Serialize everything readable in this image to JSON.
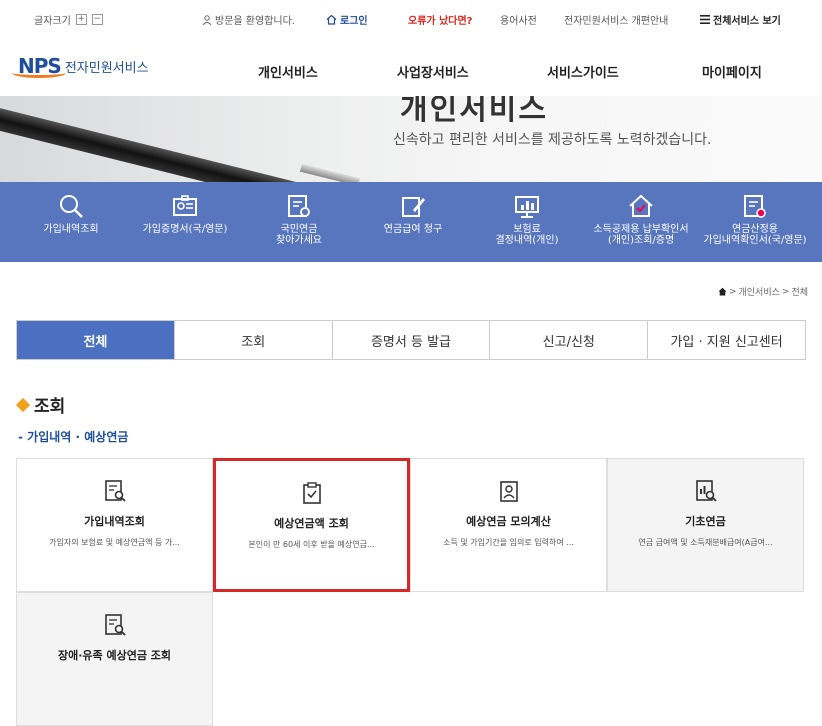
{
  "topbar": {
    "font_size_label": "글자크기",
    "font_plus": "+",
    "font_minus": "−",
    "welcome": "방문을 환영합니다.",
    "login": "로그인",
    "error_report": "오류가 났다면?",
    "glossary": "용어사전",
    "reform_notice": "전자민원서비스 개편안내",
    "all_services": "전체서비스 보기"
  },
  "header": {
    "logo_nps": "NPS",
    "logo_text": "전자민원서비스",
    "nav": [
      "개인서비스",
      "사업장서비스",
      "서비스가이드",
      "마이페이지"
    ]
  },
  "hero": {
    "title": "개인서비스",
    "subtitle": "신속하고 편리한 서비스를 제공하도록 노력하겠습니다."
  },
  "quickmenu": [
    {
      "label1": "가입내역조회",
      "label2": "",
      "icon": "search-icon"
    },
    {
      "label1": "가입증명서(국/영문)",
      "label2": "",
      "icon": "id-card-icon"
    },
    {
      "label1": "국민연금",
      "label2": "찾아가세요",
      "icon": "document-search-icon"
    },
    {
      "label1": "연금급여 청구",
      "label2": "",
      "icon": "edit-document-icon"
    },
    {
      "label1": "보험료",
      "label2": "결정내역(개인)",
      "icon": "monitor-chart-icon"
    },
    {
      "label1": "소득공제용 납부확인서",
      "label2": "(개인)조회/증명",
      "icon": "house-check-icon"
    },
    {
      "label1": "연금산정용",
      "label2": "가입내역확인서(국/영문)",
      "icon": "document-badge-icon"
    }
  ],
  "breadcrumb": {
    "path1": "개인서비스",
    "path2": "전체"
  },
  "tabs": [
    "전체",
    "조회",
    "증명서 등 발급",
    "신고/신청",
    "가입 · 지원 신고센터"
  ],
  "section": {
    "title": "조회",
    "subtitle": "- 가입내역 · 예상연금"
  },
  "cards": [
    {
      "title": "가입내역조회",
      "desc": "가입자의 보험료 및 예상연금액 등 가...",
      "icon": "document-search-icon"
    },
    {
      "title": "예상연금액 조회",
      "desc": "본인이 만 60세 이후 받을 예상연금...",
      "icon": "clipboard-check-icon"
    },
    {
      "title": "예상연금 모의계산",
      "desc": "소득 및 가입기간을 임의로 입력하여 ...",
      "icon": "person-badge-icon"
    },
    {
      "title": "기초연금",
      "desc": "연금 급여액 및 소득재분배급여(A급여...",
      "icon": "chart-search-icon"
    },
    {
      "title": "장애·유족 예상연금 조회",
      "desc": "",
      "icon": "document-search-icon"
    }
  ],
  "colors": {
    "brand_blue": "#1f4e9c",
    "quickbar": "#5876bd",
    "active_tab": "#4b6fc1",
    "highlight": "#d62828",
    "accent": "#f0a21e"
  }
}
